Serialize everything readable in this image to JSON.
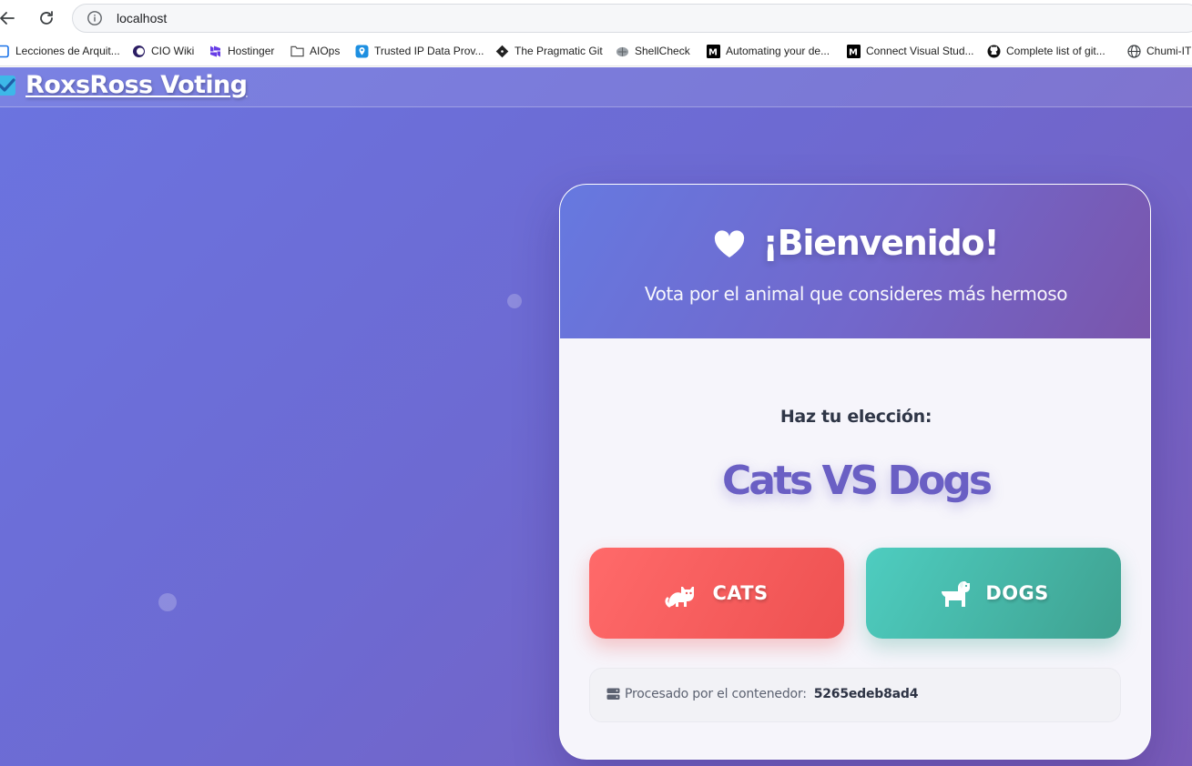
{
  "browser": {
    "url": "localhost",
    "bookmarks": [
      {
        "label": "Lecciones de Arquit...",
        "icon": "box-icon"
      },
      {
        "label": "CIO Wiki",
        "icon": "cio-icon"
      },
      {
        "label": "Hostinger",
        "icon": "hostinger-icon"
      },
      {
        "label": "AIOps",
        "icon": "folder-icon"
      },
      {
        "label": "Trusted IP Data Prov...",
        "icon": "location-icon"
      },
      {
        "label": "The Pragmatic Git",
        "icon": "git-icon"
      },
      {
        "label": "ShellCheck",
        "icon": "shellcheck-icon"
      },
      {
        "label": "Automating your de...",
        "icon": "medium-icon"
      },
      {
        "label": "Connect Visual Stud...",
        "icon": "medium-icon"
      },
      {
        "label": "Complete list of git...",
        "icon": "github-icon"
      },
      {
        "label": "Chumi-IT",
        "icon": "globe-icon"
      }
    ]
  },
  "app": {
    "brand": "RoxsRoss Voting",
    "card": {
      "title": "¡Bienvenido!",
      "subtitle": "Vota por el animal que consideres más hermoso",
      "prompt": "Haz tu elección:",
      "vs_title": "Cats VS Dogs",
      "option_a": "CATS",
      "option_b": "DOGS",
      "container_label": "Procesado por el contenedor:",
      "container_id": "5265edeb8ad4"
    }
  },
  "colors": {
    "page_gradient_start": "#6b74e0",
    "page_gradient_end": "#7a5cba",
    "cats_button": "#ff6a6a",
    "dogs_button": "#4ecdc0",
    "vs_title": "#6a5fc4"
  }
}
